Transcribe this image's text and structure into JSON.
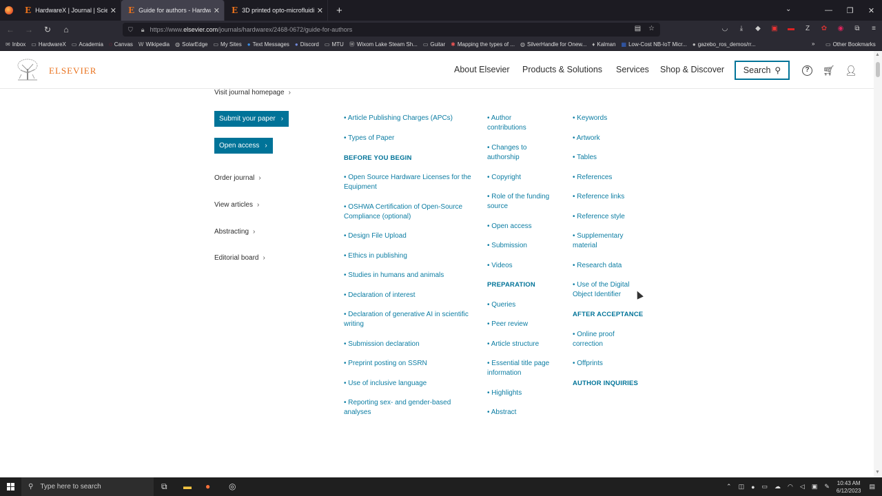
{
  "browser": {
    "tabs": [
      {
        "label": "HardwareX | Journal | ScienceD",
        "active": false
      },
      {
        "label": "Guide for authors - HardwareX",
        "active": true
      },
      {
        "label": "3D printed opto-microfluidic a",
        "active": false
      }
    ],
    "url_prefix": "https://www.",
    "url_host": "elsevier.com",
    "url_path": "/journals/hardwarex/2468-0672/guide-for-authors",
    "bookmarks": [
      "Inbox",
      "HardwareX",
      "Academia",
      "Canvas",
      "Wikipedia",
      "SolarEdge",
      "My Sites",
      "Text Messages",
      "Discord",
      "MTU",
      "Wixom Lake Steam Sh...",
      "Guitar",
      "Mapping the types of ...",
      "SilverHandle for Onew...",
      "Kalman",
      "Low-Cost NB-IoT Micr...",
      "gazebo_ros_demos/rr..."
    ],
    "other_bookmarks": "Other Bookmarks"
  },
  "header": {
    "logo_text": "ELSEVIER",
    "nav": [
      "About Elsevier",
      "Products & Solutions",
      "Services",
      "Shop & Discover"
    ],
    "search_label": "Search"
  },
  "sidebar": {
    "visit_homepage": "Visit journal homepage",
    "submit_paper": "Submit your paper",
    "open_access": "Open access",
    "links": [
      "Order journal",
      "View articles",
      "Abstracting",
      "Editorial board"
    ]
  },
  "toc": {
    "col1": [
      {
        "type": "item",
        "text": "Article Publishing Charges (APCs)"
      },
      {
        "type": "item",
        "text": "Types of Paper"
      },
      {
        "type": "head",
        "text": "BEFORE YOU BEGIN"
      },
      {
        "type": "item",
        "text": "Open Source Hardware Licenses for the Equipment"
      },
      {
        "type": "item",
        "text": "OSHWA Certification of Open-Source Compliance (optional)"
      },
      {
        "type": "item",
        "text": "Design File Upload"
      },
      {
        "type": "item",
        "text": "Ethics in publishing"
      },
      {
        "type": "item",
        "text": "Studies in humans and animals"
      },
      {
        "type": "item",
        "text": "Declaration of interest"
      },
      {
        "type": "item",
        "text": "Declaration of generative AI in scientific writing"
      },
      {
        "type": "item",
        "text": "Submission declaration"
      },
      {
        "type": "item",
        "text": "Preprint posting on SSRN"
      },
      {
        "type": "item",
        "text": "Use of inclusive language"
      },
      {
        "type": "item",
        "text": "Reporting sex- and gender-based analyses"
      }
    ],
    "col2": [
      {
        "type": "item",
        "text": "Author contributions"
      },
      {
        "type": "item",
        "text": "Changes to authorship"
      },
      {
        "type": "item",
        "text": "Copyright"
      },
      {
        "type": "item",
        "text": "Role of the funding source"
      },
      {
        "type": "item",
        "text": "Open access"
      },
      {
        "type": "item",
        "text": "Submission"
      },
      {
        "type": "item",
        "text": "Videos"
      },
      {
        "type": "head",
        "text": "PREPARATION"
      },
      {
        "type": "item",
        "text": "Queries"
      },
      {
        "type": "item",
        "text": "Peer review"
      },
      {
        "type": "item",
        "text": "Article structure"
      },
      {
        "type": "item",
        "text": "Essential title page information"
      },
      {
        "type": "item",
        "text": "Highlights"
      },
      {
        "type": "item",
        "text": "Abstract"
      }
    ],
    "col3": [
      {
        "type": "item",
        "text": "Keywords"
      },
      {
        "type": "item",
        "text": "Artwork"
      },
      {
        "type": "item",
        "text": "Tables"
      },
      {
        "type": "item",
        "text": "References"
      },
      {
        "type": "item",
        "text": "Reference links"
      },
      {
        "type": "item",
        "text": "Reference style"
      },
      {
        "type": "item",
        "text": "Supplementary material"
      },
      {
        "type": "item",
        "text": "Research data"
      },
      {
        "type": "item",
        "text": "Use of the Digital Object Identifier"
      },
      {
        "type": "head",
        "text": "AFTER ACCEPTANCE"
      },
      {
        "type": "item",
        "text": "Online proof correction"
      },
      {
        "type": "item",
        "text": "Offprints"
      },
      {
        "type": "head",
        "text": "AUTHOR INQUIRIES"
      }
    ]
  },
  "taskbar": {
    "search_placeholder": "Type here to search",
    "time": "10:43 AM",
    "date": "6/12/2023"
  }
}
